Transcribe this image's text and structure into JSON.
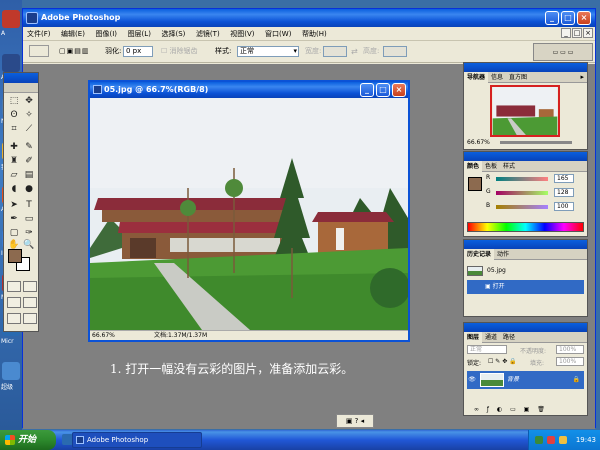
{
  "desktop": {
    "icons": [
      {
        "label": "A",
        "color": "#c0392b"
      },
      {
        "label": "Adobe Photos",
        "color": "#2a4a8a"
      },
      {
        "label": "Net",
        "color": "#4a7ab0"
      },
      {
        "label": "我的",
        "color": "#e8b030"
      },
      {
        "label": "ACD",
        "color": "#e05020"
      },
      {
        "label": "Int Exp",
        "color": "#3a7ad0"
      },
      {
        "label": "Mic",
        "color": "#b03030"
      },
      {
        "label": "Micr",
        "color": "#2a6ab0"
      },
      {
        "label": "超级",
        "color": "#4a8ad0"
      }
    ]
  },
  "ps_window": {
    "title": "Adobe Photoshop",
    "buttons": {
      "minimize": "_",
      "maximize": "□",
      "close": "×"
    },
    "menu": [
      "文件(F)",
      "编辑(E)",
      "图像(I)",
      "图层(L)",
      "选择(S)",
      "滤镜(T)",
      "视图(V)",
      "窗口(W)",
      "帮助(H)"
    ],
    "options_bar": {
      "feather_label": "羽化:",
      "feather_value": "0 px",
      "antialias_label": "消除锯齿",
      "style_label": "样式:",
      "style_value": "正常",
      "width_label": "宽度:",
      "height_label": "高度:"
    }
  },
  "document": {
    "title": "05.jpg @ 66.7%(RGB/8)",
    "zoom": "66.67%",
    "doc_size": "文档:1.37M/1.37M"
  },
  "caption": "1. 打开一幅没有云彩的图片，准备添加云彩。",
  "navigator_panel": {
    "tabs": [
      "导航器",
      "信息",
      "直方图"
    ],
    "zoom": "66.67%"
  },
  "color_panel": {
    "tabs": [
      "颜色",
      "色板",
      "样式"
    ],
    "channels": [
      {
        "name": "R",
        "value": "165",
        "gradient": "linear-gradient(90deg,#008080,#ff8080)"
      },
      {
        "name": "G",
        "value": "128",
        "gradient": "linear-gradient(90deg,#a50064,#a5ff64)"
      },
      {
        "name": "B",
        "value": "100",
        "gradient": "linear-gradient(90deg,#a58000,#a580ff)"
      }
    ],
    "foreground_hex": "#8c6a4f"
  },
  "history_panel": {
    "tabs": [
      "历史记录",
      "动作"
    ],
    "snapshot": "05.jpg",
    "states": [
      "打开"
    ]
  },
  "layers_panel": {
    "tabs": [
      "图层",
      "通道",
      "路径"
    ],
    "blend_mode": "正常",
    "opacity_label": "不透明度:",
    "opacity_value": "100%",
    "lock_label": "锁定:",
    "fill_label": "填充:",
    "fill_value": "100%",
    "layers": [
      {
        "name": "背景",
        "visible": true,
        "locked": true
      }
    ]
  },
  "taskbar": {
    "start_label": "开始",
    "task_photoshop": "Adobe Photoshop",
    "clock": "19:43"
  }
}
